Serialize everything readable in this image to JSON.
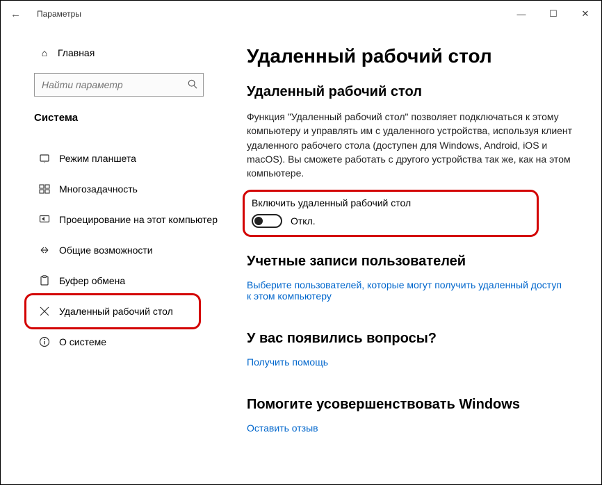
{
  "titlebar": {
    "title": "Параметры"
  },
  "sidebar": {
    "home": "Главная",
    "search_placeholder": "Найти параметр",
    "section": "Система",
    "items": [
      {
        "icon": "tablet",
        "label": "Режим планшета"
      },
      {
        "icon": "multitask",
        "label": "Многозадачность"
      },
      {
        "icon": "project",
        "label": "Проецирование на этот компьютер"
      },
      {
        "icon": "shared",
        "label": "Общие возможности"
      },
      {
        "icon": "clipboard",
        "label": "Буфер обмена"
      },
      {
        "icon": "remote",
        "label": "Удаленный рабочий стол"
      },
      {
        "icon": "about",
        "label": "О системе"
      }
    ]
  },
  "main": {
    "h1": "Удаленный рабочий стол",
    "h2_remote": "Удаленный рабочий стол",
    "desc": "Функция \"Удаленный рабочий стол\" позволяет подключаться к этому компьютеру и управлять им с удаленного устройства, используя клиент удаленного рабочего стола (доступен для Windows, Android, iOS и macOS). Вы сможете работать с другого устройства так же, как на этом компьютере.",
    "toggle_label": "Включить удаленный рабочий стол",
    "toggle_state": "Откл.",
    "h2_accounts": "Учетные записи пользователей",
    "link_users": "Выберите пользователей, которые могут получить удаленный доступ к этом компьютеру",
    "h2_questions": "У вас появились вопросы?",
    "link_help": "Получить помощь",
    "h2_improve": "Помогите усовершенствовать Windows",
    "link_feedback": "Оставить отзыв"
  }
}
